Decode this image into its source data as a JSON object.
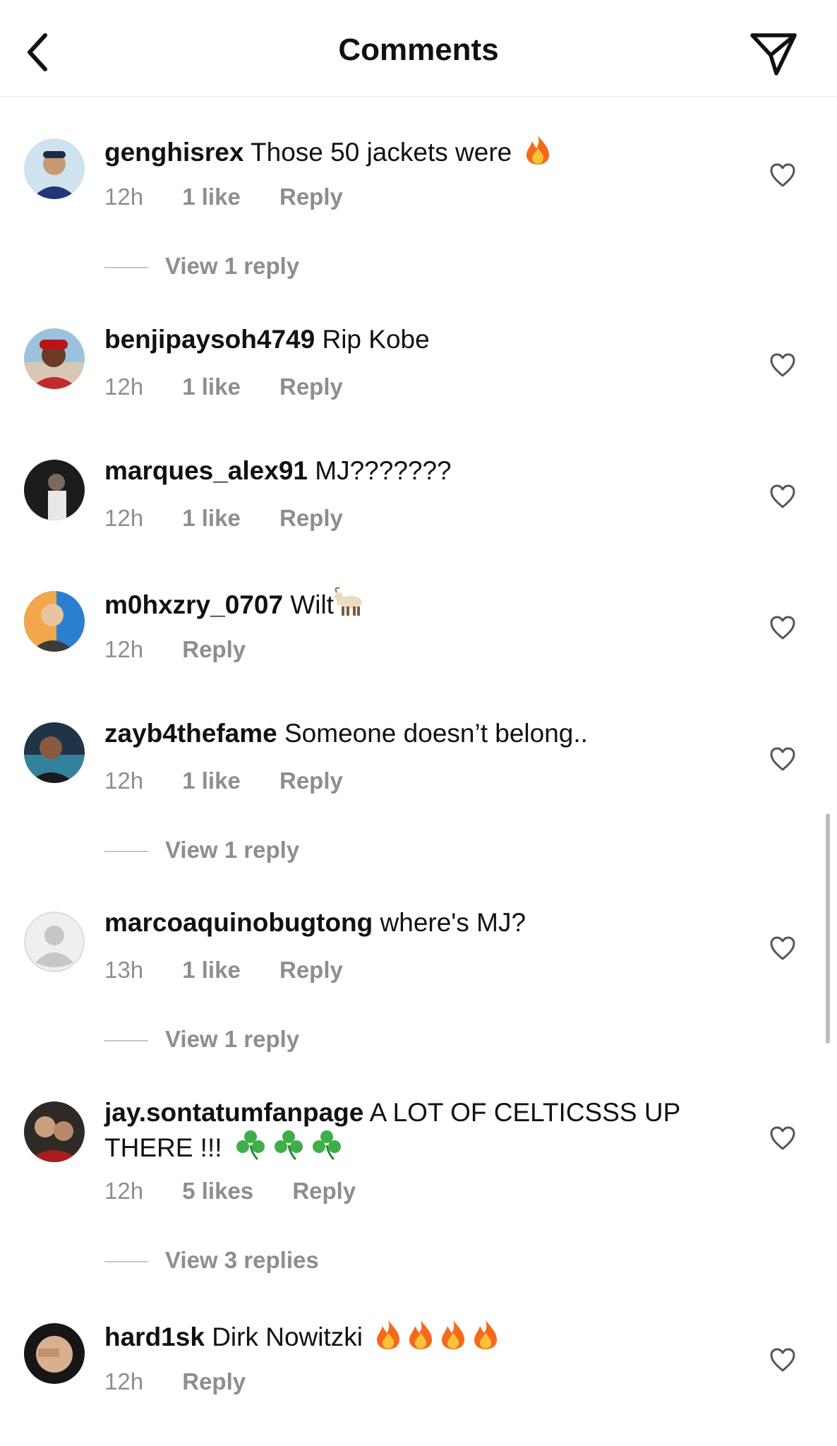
{
  "header": {
    "title": "Comments",
    "back_icon": "chevron-left-icon",
    "send_icon": "paper-plane-icon"
  },
  "comments": [
    {
      "username": "genghisrex",
      "text": "Those 50 jackets were",
      "emoji": [
        "fire"
      ],
      "time": "12h",
      "likes": "1 like",
      "reply": "Reply",
      "view_replies": "View 1 reply"
    },
    {
      "username": "benjipaysoh4749",
      "text": "Rip Kobe",
      "time": "12h",
      "likes": "1 like",
      "reply": "Reply"
    },
    {
      "username": "marques_alex91",
      "text": "MJ???????",
      "time": "12h",
      "likes": "1 like",
      "reply": "Reply"
    },
    {
      "username": "m0hxzry_0707",
      "text": "Wilt",
      "emoji": [
        "goat"
      ],
      "time": "12h",
      "reply": "Reply"
    },
    {
      "username": "zayb4thefame",
      "text": "Someone doesn’t belong..",
      "time": "12h",
      "likes": "1 like",
      "reply": "Reply",
      "view_replies": "View 1 reply"
    },
    {
      "username": "marcoaquinobugtong",
      "text": "where's MJ?",
      "time": "13h",
      "likes": "1 like",
      "reply": "Reply",
      "view_replies": "View 1 reply"
    },
    {
      "username": "jay.sontatumfanpage",
      "text": "A LOT OF CELTICSSS UP THERE !!!",
      "emoji": [
        "shamrock",
        "shamrock",
        "shamrock"
      ],
      "time": "12h",
      "likes": "5 likes",
      "reply": "Reply",
      "view_replies": "View 3 replies"
    },
    {
      "username": "hard1sk",
      "text": "Dirk Nowitzki",
      "emoji": [
        "fire",
        "fire",
        "fire",
        "fire"
      ],
      "time": "12h",
      "reply": "Reply"
    }
  ],
  "colors": {
    "text": "#111111",
    "muted": "#8e8e8e",
    "divider": "#e6e6e6"
  }
}
